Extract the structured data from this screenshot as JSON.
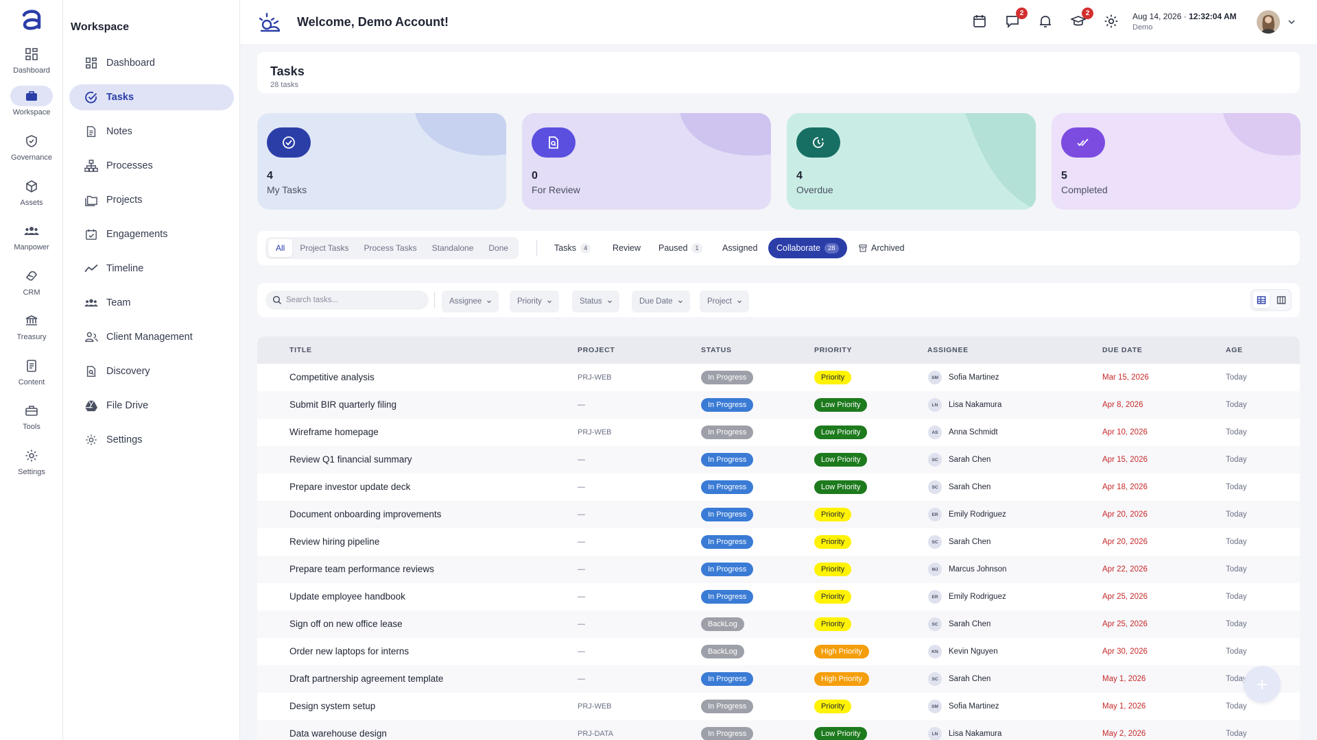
{
  "colors": {
    "accent": "#2b3ea8",
    "status_in_progress": "#3a7bd5",
    "status_backlog": "#9da0a8",
    "priority_medium": "#fff203",
    "priority_low": "#1d7a1d",
    "priority_high": "#f59e0b",
    "due_date": "#c62828"
  },
  "rail": {
    "items": [
      {
        "label": "Dashboard",
        "icon": "grid-icon"
      },
      {
        "label": "Workspace",
        "icon": "briefcase-icon"
      },
      {
        "label": "Governance",
        "icon": "shield-check-icon"
      },
      {
        "label": "Assets",
        "icon": "cube-icon"
      },
      {
        "label": "Manpower",
        "icon": "people-icon"
      },
      {
        "label": "CRM",
        "icon": "handshake-icon"
      },
      {
        "label": "Treasury",
        "icon": "bank-icon"
      },
      {
        "label": "Content",
        "icon": "document-icon"
      },
      {
        "label": "Tools",
        "icon": "toolbox-icon"
      },
      {
        "label": "Settings",
        "icon": "gear-icon"
      }
    ]
  },
  "sidebar": {
    "title": "Workspace",
    "items": [
      {
        "label": "Dashboard"
      },
      {
        "label": "Tasks"
      },
      {
        "label": "Notes"
      },
      {
        "label": "Processes"
      },
      {
        "label": "Projects"
      },
      {
        "label": "Engagements"
      },
      {
        "label": "Timeline"
      },
      {
        "label": "Team"
      },
      {
        "label": "Client Management"
      },
      {
        "label": "Discovery"
      },
      {
        "label": "File Drive"
      },
      {
        "label": "Settings"
      }
    ]
  },
  "header": {
    "welcome": "Welcome, Demo Account!",
    "messages_badge": "2",
    "learning_badge": "2",
    "date": "Aug 14, 2026",
    "time": "12:32:04 AM",
    "user": "Demo"
  },
  "page": {
    "title": "Tasks",
    "subtitle": "28 tasks"
  },
  "cards": [
    {
      "count": "4",
      "label": "My Tasks"
    },
    {
      "count": "0",
      "label": "For Review"
    },
    {
      "count": "4",
      "label": "Overdue"
    },
    {
      "count": "5",
      "label": "Completed"
    }
  ],
  "tabs": {
    "segments": [
      "All",
      "Project Tasks",
      "Process Tasks",
      "Standalone",
      "Done"
    ],
    "views": [
      {
        "label": "Tasks",
        "count": "4"
      },
      {
        "label": "Review",
        "count": ""
      },
      {
        "label": "Paused",
        "count": "1"
      },
      {
        "label": "Assigned",
        "count": ""
      },
      {
        "label": "Collaborate",
        "count": "28"
      },
      {
        "label": "Archived",
        "count": ""
      }
    ]
  },
  "filters": {
    "search_placeholder": "Search tasks...",
    "dropdowns": [
      "Assignee",
      "Priority",
      "Status",
      "Due Date",
      "Project"
    ]
  },
  "table": {
    "columns": [
      "TITLE",
      "PROJECT",
      "STATUS",
      "PRIORITY",
      "ASSIGNEE",
      "DUE DATE",
      "AGE"
    ],
    "rows": [
      {
        "title": "Competitive analysis",
        "project": "PRJ-WEB",
        "status": "In Progress",
        "status_kind": "grey",
        "priority": "Priority",
        "priority_kind": "medium",
        "initials": "SM",
        "assignee": "Sofia Martinez",
        "due": "Mar 15, 2026",
        "age": "Today"
      },
      {
        "title": "Submit BIR quarterly filing",
        "project": "—",
        "status": "In Progress",
        "status_kind": "blue",
        "priority": "Low Priority",
        "priority_kind": "low",
        "initials": "LN",
        "assignee": "Lisa Nakamura",
        "due": "Apr 8, 2026",
        "age": "Today"
      },
      {
        "title": "Wireframe homepage",
        "project": "PRJ-WEB",
        "status": "In Progress",
        "status_kind": "grey",
        "priority": "Low Priority",
        "priority_kind": "low",
        "initials": "AS",
        "assignee": "Anna Schmidt",
        "due": "Apr 10, 2026",
        "age": "Today"
      },
      {
        "title": "Review Q1 financial summary",
        "project": "—",
        "status": "In Progress",
        "status_kind": "blue",
        "priority": "Low Priority",
        "priority_kind": "low",
        "initials": "SC",
        "assignee": "Sarah Chen",
        "due": "Apr 15, 2026",
        "age": "Today"
      },
      {
        "title": "Prepare investor update deck",
        "project": "—",
        "status": "In Progress",
        "status_kind": "blue",
        "priority": "Low Priority",
        "priority_kind": "low",
        "initials": "SC",
        "assignee": "Sarah Chen",
        "due": "Apr 18, 2026",
        "age": "Today"
      },
      {
        "title": "Document onboarding improvements",
        "project": "—",
        "status": "In Progress",
        "status_kind": "blue",
        "priority": "Priority",
        "priority_kind": "medium",
        "initials": "ER",
        "assignee": "Emily Rodriguez",
        "due": "Apr 20, 2026",
        "age": "Today"
      },
      {
        "title": "Review hiring pipeline",
        "project": "—",
        "status": "In Progress",
        "status_kind": "blue",
        "priority": "Priority",
        "priority_kind": "medium",
        "initials": "SC",
        "assignee": "Sarah Chen",
        "due": "Apr 20, 2026",
        "age": "Today"
      },
      {
        "title": "Prepare team performance reviews",
        "project": "—",
        "status": "In Progress",
        "status_kind": "blue",
        "priority": "Priority",
        "priority_kind": "medium",
        "initials": "MJ",
        "assignee": "Marcus Johnson",
        "due": "Apr 22, 2026",
        "age": "Today"
      },
      {
        "title": "Update employee handbook",
        "project": "—",
        "status": "In Progress",
        "status_kind": "blue",
        "priority": "Priority",
        "priority_kind": "medium",
        "initials": "ER",
        "assignee": "Emily Rodriguez",
        "due": "Apr 25, 2026",
        "age": "Today"
      },
      {
        "title": "Sign off on new office lease",
        "project": "—",
        "status": "BackLog",
        "status_kind": "grey",
        "priority": "Priority",
        "priority_kind": "medium",
        "initials": "SC",
        "assignee": "Sarah Chen",
        "due": "Apr 25, 2026",
        "age": "Today"
      },
      {
        "title": "Order new laptops for interns",
        "project": "—",
        "status": "BackLog",
        "status_kind": "grey",
        "priority": "High Priority",
        "priority_kind": "high",
        "initials": "KN",
        "assignee": "Kevin Nguyen",
        "due": "Apr 30, 2026",
        "age": "Today"
      },
      {
        "title": "Draft partnership agreement template",
        "project": "—",
        "status": "In Progress",
        "status_kind": "blue",
        "priority": "High Priority",
        "priority_kind": "high",
        "initials": "SC",
        "assignee": "Sarah Chen",
        "due": "May 1, 2026",
        "age": "Today"
      },
      {
        "title": "Design system setup",
        "project": "PRJ-WEB",
        "status": "In Progress",
        "status_kind": "grey",
        "priority": "Priority",
        "priority_kind": "medium",
        "initials": "SM",
        "assignee": "Sofia Martinez",
        "due": "May 1, 2026",
        "age": "Today"
      },
      {
        "title": "Data warehouse design",
        "project": "PRJ-DATA",
        "status": "In Progress",
        "status_kind": "grey",
        "priority": "Low Priority",
        "priority_kind": "low",
        "initials": "LN",
        "assignee": "Lisa Nakamura",
        "due": "May 2, 2026",
        "age": "Today"
      }
    ]
  }
}
